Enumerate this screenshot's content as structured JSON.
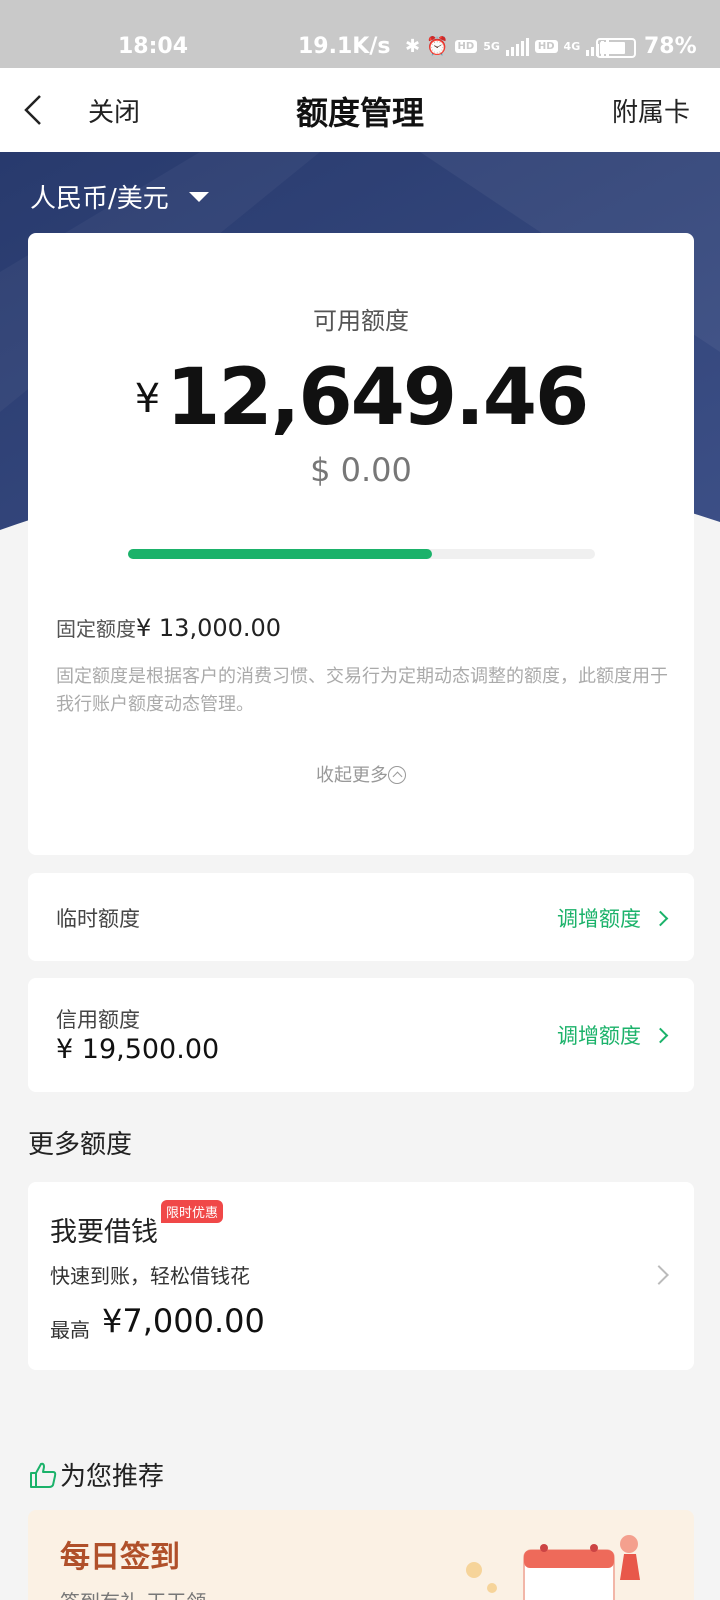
{
  "status_bar": {
    "time": "18:04",
    "speed": "19.1K/s",
    "net1": "5G",
    "net2": "4G",
    "hd": "HD",
    "battery_pct": "78%",
    "battery_level": 0.78
  },
  "nav": {
    "close_label": "关闭",
    "title": "额度管理",
    "subcard_label": "附属卡"
  },
  "currency": {
    "selected": "人民币/美元"
  },
  "available": {
    "label": "可用额度",
    "yen_sign": "¥",
    "amount": "12,649.46",
    "usd_amount": "$ 0.00",
    "progress_fraction": 0.65
  },
  "fixed_limit": {
    "label": "固定额度",
    "value": "¥ 13,000.00",
    "description": "固定额度是根据客户的消费习惯、交易行为定期动态调整的额度，此额度用于我行账户额度动态管理。",
    "collapse_label": "收起更多"
  },
  "temp_limit": {
    "label": "临时额度",
    "action": "调增额度"
  },
  "credit_limit": {
    "label": "信用额度",
    "value": "¥ 19,500.00",
    "action": "调增额度"
  },
  "more_limits": {
    "title": "更多额度",
    "loan": {
      "title": "我要借钱",
      "badge": "限时优惠",
      "subtitle": "快速到账，轻松借钱花",
      "max_label": "最高",
      "max_value": "¥7,000.00"
    }
  },
  "recommend": {
    "title": "为您推荐",
    "banner_title": "每日签到",
    "banner_sub": "签到有礼 天天领"
  },
  "colors": {
    "accent_green": "#1bb26a",
    "hero_blue": "#2e3f72",
    "badge_red": "#f04848"
  }
}
